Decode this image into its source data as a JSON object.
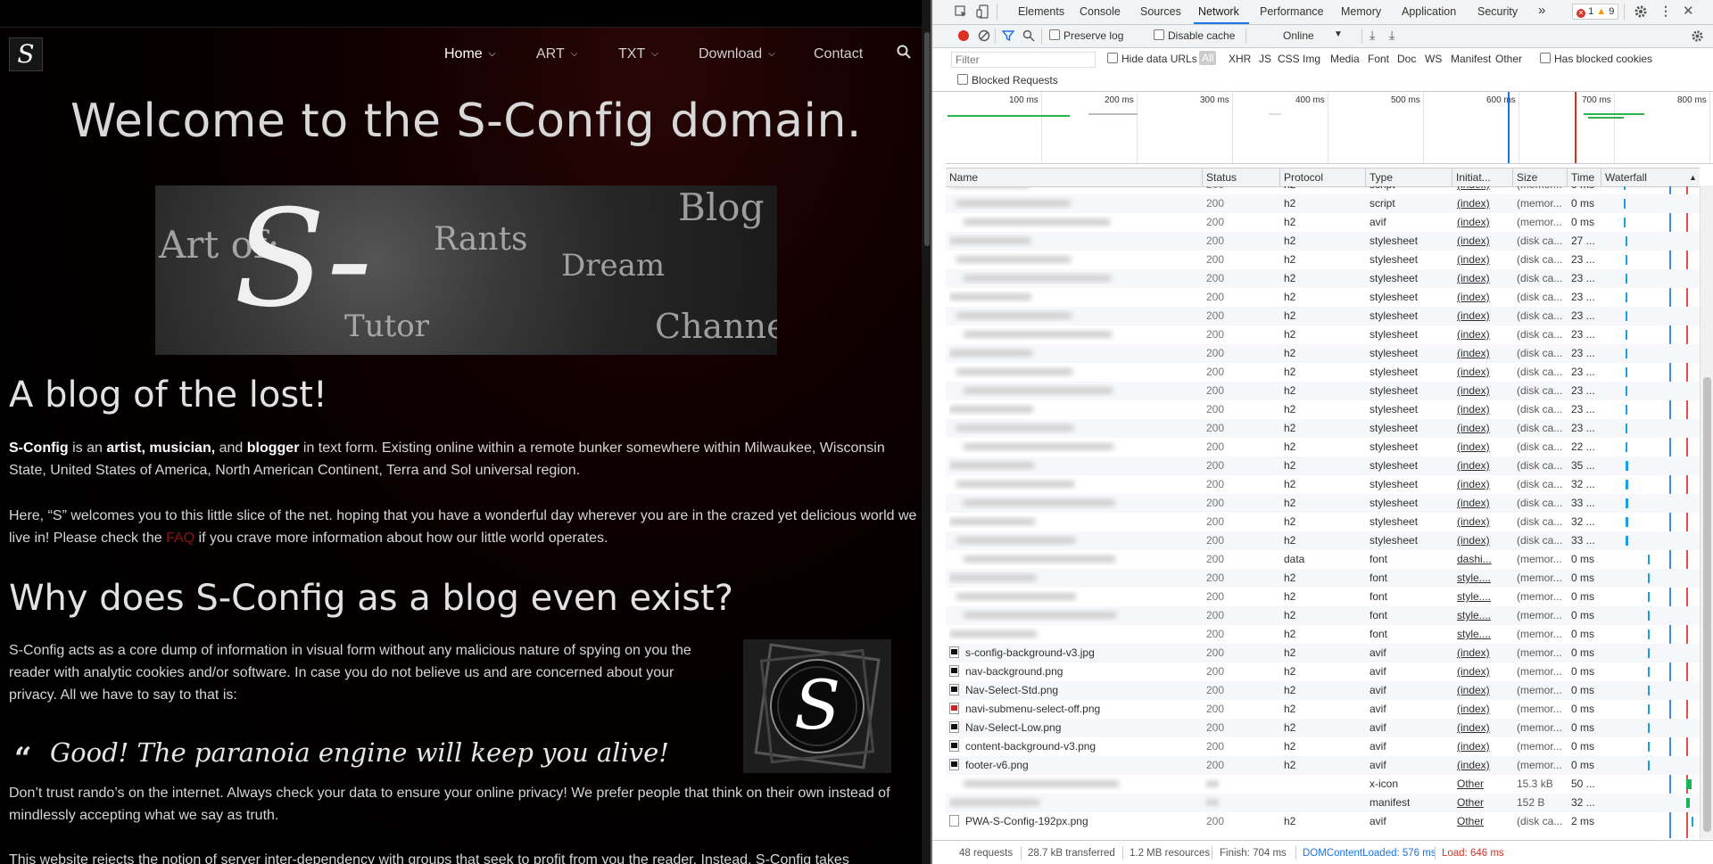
{
  "site": {
    "logo_letter": "S",
    "nav": [
      {
        "label": "Home",
        "dropdown": true,
        "active": true
      },
      {
        "label": "ART",
        "dropdown": true
      },
      {
        "label": "TXT",
        "dropdown": true
      },
      {
        "label": "Download",
        "dropdown": true
      },
      {
        "label": "Contact",
        "dropdown": false
      }
    ],
    "search_icon": "search-icon",
    "title": "Welcome to the S-Config domain.",
    "banner": {
      "art_of": "Art of:",
      "main": "S-Config",
      "blog": "Blog",
      "rants": "Rants",
      "dream": "Dream",
      "tutor": "Tutor",
      "channel": "Channel"
    },
    "heading_lost": "A blog of the lost!",
    "intro": {
      "name": "S-Config",
      "is_an": " is an ",
      "artist": "artist, musician,",
      "and": " and ",
      "blogger": "blogger",
      "rest": " in text form. Existing online within a remote bunker somewhere within Milwaukee, Wisconsin State, United States of America, North American Continent, Terra and Sol universal region."
    },
    "welcome": {
      "before": "Here, “S” welcomes you to this little slice of the net. hoping that you have a wonderful day wherever you are in the crazed yet delicious world we live in! Please check the ",
      "faq": "FAQ",
      "after": " if you crave more information about how our little world operates."
    },
    "heading_why": "Why does S-Config as a blog even exist?",
    "why_text": "S-Config acts as a core dump of information in visual form without any malicious nature of spying on you the reader with analytic cookies and/or software. In case you do not believe us and are concerned about your privacy. All we have to say to that is:",
    "quote_mark": "66",
    "quote": "Good! The paranoia engine will keep you alive!",
    "trust_text": "Don’t trust rando’s on the internet. Always check your data to ensure your online privacy! We prefer people that think on their own instead of mindlessly accepting what we say as truth.",
    "reject_text": "This website rejects the notion of server inter-dependency with groups that seek to profit from you the reader. Instead, S-Config takes"
  },
  "devtools": {
    "tabs": [
      "Elements",
      "Console",
      "Sources",
      "Network",
      "Performance",
      "Memory",
      "Application",
      "Security"
    ],
    "active_tab": "Network",
    "more_tabs": "»",
    "errors": "1",
    "warnings": "9",
    "toolbar": {
      "preserve_log": "Preserve log",
      "disable_cache": "Disable cache",
      "throttle": "Online"
    },
    "filter": {
      "placeholder": "Filter",
      "hide_data_urls": "Hide data URLs",
      "types": [
        "All",
        "XHR",
        "JS",
        "CSS",
        "Img",
        "Media",
        "Font",
        "Doc",
        "WS",
        "Manifest",
        "Other"
      ],
      "has_blocked_cookies": "Has blocked cookies",
      "blocked_requests": "Blocked Requests"
    },
    "overview_labels": [
      "100 ms",
      "200 ms",
      "300 ms",
      "400 ms",
      "500 ms",
      "600 ms",
      "700 ms",
      "800 ms"
    ],
    "columns": [
      "Name",
      "Status",
      "Protocol",
      "Type",
      "Initiat...",
      "Size",
      "Time",
      "Waterfall"
    ],
    "rows": [
      {
        "name": "",
        "status": "200",
        "protocol": "h2",
        "type": "script",
        "initiator": "(index)",
        "size": "(memor...",
        "time": "0 ms",
        "icon": "none",
        "wf": 0.05
      },
      {
        "name": "",
        "status": "200",
        "protocol": "h2",
        "type": "script",
        "initiator": "(index)",
        "size": "(memor...",
        "time": "0 ms",
        "icon": "none",
        "wf": 0.05
      },
      {
        "name": "",
        "status": "200",
        "protocol": "h2",
        "type": "avif",
        "initiator": "(index)",
        "size": "(memor...",
        "time": "0 ms",
        "icon": "none",
        "wf": 0.05
      },
      {
        "name": "",
        "status": "200",
        "protocol": "h2",
        "type": "stylesheet",
        "initiator": "(index)",
        "size": "(disk ca...",
        "time": "27 ...",
        "icon": "none",
        "wf": 0.2
      },
      {
        "name": "",
        "status": "200",
        "protocol": "h2",
        "type": "stylesheet",
        "initiator": "(index)",
        "size": "(disk ca...",
        "time": "23 ...",
        "icon": "none",
        "wf": 0.2
      },
      {
        "name": "",
        "status": "200",
        "protocol": "h2",
        "type": "stylesheet",
        "initiator": "(index)",
        "size": "(disk ca...",
        "time": "23 ...",
        "icon": "none",
        "wf": 0.2
      },
      {
        "name": "",
        "status": "200",
        "protocol": "h2",
        "type": "stylesheet",
        "initiator": "(index)",
        "size": "(disk ca...",
        "time": "23 ...",
        "icon": "none",
        "wf": 0.2
      },
      {
        "name": "",
        "status": "200",
        "protocol": "h2",
        "type": "stylesheet",
        "initiator": "(index)",
        "size": "(disk ca...",
        "time": "23 ...",
        "icon": "none",
        "wf": 0.2
      },
      {
        "name": "",
        "status": "200",
        "protocol": "h2",
        "type": "stylesheet",
        "initiator": "(index)",
        "size": "(disk ca...",
        "time": "23 ...",
        "icon": "none",
        "wf": 0.2
      },
      {
        "name": "",
        "status": "200",
        "protocol": "h2",
        "type": "stylesheet",
        "initiator": "(index)",
        "size": "(disk ca...",
        "time": "23 ...",
        "icon": "none",
        "wf": 0.2
      },
      {
        "name": "",
        "status": "200",
        "protocol": "h2",
        "type": "stylesheet",
        "initiator": "(index)",
        "size": "(disk ca...",
        "time": "23 ...",
        "icon": "none",
        "wf": 0.2
      },
      {
        "name": "",
        "status": "200",
        "protocol": "h2",
        "type": "stylesheet",
        "initiator": "(index)",
        "size": "(disk ca...",
        "time": "23 ...",
        "icon": "none",
        "wf": 0.2
      },
      {
        "name": "",
        "status": "200",
        "protocol": "h2",
        "type": "stylesheet",
        "initiator": "(index)",
        "size": "(disk ca...",
        "time": "23 ...",
        "icon": "none",
        "wf": 0.2
      },
      {
        "name": "",
        "status": "200",
        "protocol": "h2",
        "type": "stylesheet",
        "initiator": "(index)",
        "size": "(disk ca...",
        "time": "23 ...",
        "icon": "none",
        "wf": 0.2
      },
      {
        "name": "",
        "status": "200",
        "protocol": "h2",
        "type": "stylesheet",
        "initiator": "(index)",
        "size": "(disk ca...",
        "time": "22 ...",
        "icon": "none",
        "wf": 0.2
      },
      {
        "name": "",
        "status": "200",
        "protocol": "h2",
        "type": "stylesheet",
        "initiator": "(index)",
        "size": "(disk ca...",
        "time": "35 ...",
        "icon": "none",
        "wf": 0.3
      },
      {
        "name": "",
        "status": "200",
        "protocol": "h2",
        "type": "stylesheet",
        "initiator": "(index)",
        "size": "(disk ca...",
        "time": "32 ...",
        "icon": "none",
        "wf": 0.3
      },
      {
        "name": "",
        "status": "200",
        "protocol": "h2",
        "type": "stylesheet",
        "initiator": "(index)",
        "size": "(disk ca...",
        "time": "33 ...",
        "icon": "none",
        "wf": 0.3
      },
      {
        "name": "",
        "status": "200",
        "protocol": "h2",
        "type": "stylesheet",
        "initiator": "(index)",
        "size": "(disk ca...",
        "time": "32 ...",
        "icon": "none",
        "wf": 0.3
      },
      {
        "name": "",
        "status": "200",
        "protocol": "h2",
        "type": "stylesheet",
        "initiator": "(index)",
        "size": "(disk ca...",
        "time": "33 ...",
        "icon": "none",
        "wf": 0.3
      },
      {
        "name": "",
        "status": "200",
        "protocol": "data",
        "type": "font",
        "initiator": "dashi...",
        "size": "(memor...",
        "time": "0 ms",
        "icon": "none",
        "wf": 0.05
      },
      {
        "name": "",
        "status": "200",
        "protocol": "h2",
        "type": "font",
        "initiator": "style....",
        "size": "(memor...",
        "time": "0 ms",
        "icon": "none",
        "wf": 0.05
      },
      {
        "name": "",
        "status": "200",
        "protocol": "h2",
        "type": "font",
        "initiator": "style....",
        "size": "(memor...",
        "time": "0 ms",
        "icon": "none",
        "wf": 0.05
      },
      {
        "name": "",
        "status": "200",
        "protocol": "h2",
        "type": "font",
        "initiator": "style....",
        "size": "(memor...",
        "time": "0 ms",
        "icon": "none",
        "wf": 0.05
      },
      {
        "name": "",
        "status": "200",
        "protocol": "h2",
        "type": "font",
        "initiator": "style....",
        "size": "(memor...",
        "time": "0 ms",
        "icon": "none",
        "wf": 0.05
      },
      {
        "name": "s-config-background-v3.jpg",
        "status": "200",
        "protocol": "h2",
        "type": "avif",
        "initiator": "(index)",
        "size": "(memor...",
        "time": "0 ms",
        "icon": "img",
        "wf": 0.05
      },
      {
        "name": "nav-background.png",
        "status": "200",
        "protocol": "h2",
        "type": "avif",
        "initiator": "(index)",
        "size": "(memor...",
        "time": "0 ms",
        "icon": "img",
        "wf": 0.05
      },
      {
        "name": "Nav-Select-Std.png",
        "status": "200",
        "protocol": "h2",
        "type": "avif",
        "initiator": "(index)",
        "size": "(memor...",
        "time": "0 ms",
        "icon": "img",
        "wf": 0.05
      },
      {
        "name": "navi-submenu-select-off.png",
        "status": "200",
        "protocol": "h2",
        "type": "avif",
        "initiator": "(index)",
        "size": "(memor...",
        "time": "0 ms",
        "icon": "red",
        "wf": 0.05
      },
      {
        "name": "Nav-Select-Low.png",
        "status": "200",
        "protocol": "h2",
        "type": "avif",
        "initiator": "(index)",
        "size": "(memor...",
        "time": "0 ms",
        "icon": "img",
        "wf": 0.05
      },
      {
        "name": "content-background-v3.png",
        "status": "200",
        "protocol": "h2",
        "type": "avif",
        "initiator": "(index)",
        "size": "(memor...",
        "time": "0 ms",
        "icon": "img",
        "wf": 0.05
      },
      {
        "name": "footer-v6.png",
        "status": "200",
        "protocol": "h2",
        "type": "avif",
        "initiator": "(index)",
        "size": "(memor...",
        "time": "0 ms",
        "icon": "img",
        "wf": 0.05
      },
      {
        "name": "",
        "status": "",
        "protocol": "",
        "type": "x-icon",
        "initiator": "Other",
        "size": "15.3 kB",
        "time": "50 ...",
        "icon": "none",
        "wf": 0.6
      },
      {
        "name": "",
        "status": "",
        "protocol": "",
        "type": "manifest",
        "initiator": "Other",
        "size": "152 B",
        "time": "32 ...",
        "icon": "none",
        "wf": 0.4
      },
      {
        "name": "PWA-S-Config-192px.png",
        "status": "200",
        "protocol": "h2",
        "type": "avif",
        "initiator": "Other",
        "size": "(disk ca...",
        "time": "2 ms",
        "icon": "plain",
        "wf": 0.05
      }
    ],
    "status_bar": {
      "requests": "48 requests",
      "transferred": "28.7 kB transferred",
      "resources": "1.2 MB resources",
      "finish": "Finish: 704 ms",
      "dcl": "DOMContentLoaded: 576 ms",
      "load": "Load: 646 ms"
    },
    "colors": {
      "dcl": "#1a73e8",
      "load": "#d93025",
      "accent": "#1a73e8",
      "record": "#d93025"
    }
  }
}
